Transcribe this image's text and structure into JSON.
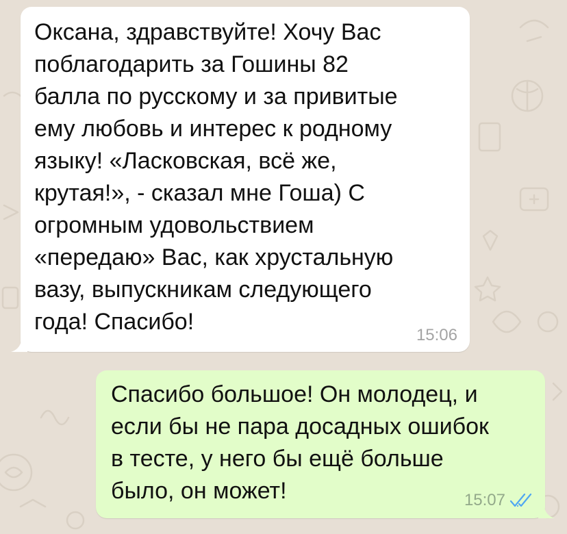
{
  "colors": {
    "chat_background": "#e7dfd5",
    "incoming_bubble": "#ffffff",
    "outgoing_bubble": "#e2fdc9",
    "read_ticks": "#4fa6f2"
  },
  "messages": [
    {
      "direction": "incoming",
      "text": "Оксана, здравствуйте! Хочу Вас\nпоблагодарить за Гошины 82\nбалла по русскому и за привитые\nему любовь и интерес к родному\nязыку! «Ласковская, всё же,\nкрутая!», - сказал мне Гоша) С\nогромным удовольствием\n«передаю» Вас, как хрустальную\nвазу, выпускникам следующего\nгода! Спасибо!",
      "time": "15:06"
    },
    {
      "direction": "outgoing",
      "text": "Спасибо большое! Он молодец, и\nесли бы не пара досадных ошибок\nв тесте, у него бы ещё больше\nбыло, он может!",
      "time": "15:07",
      "status_icon": "double-check-read-icon"
    }
  ]
}
